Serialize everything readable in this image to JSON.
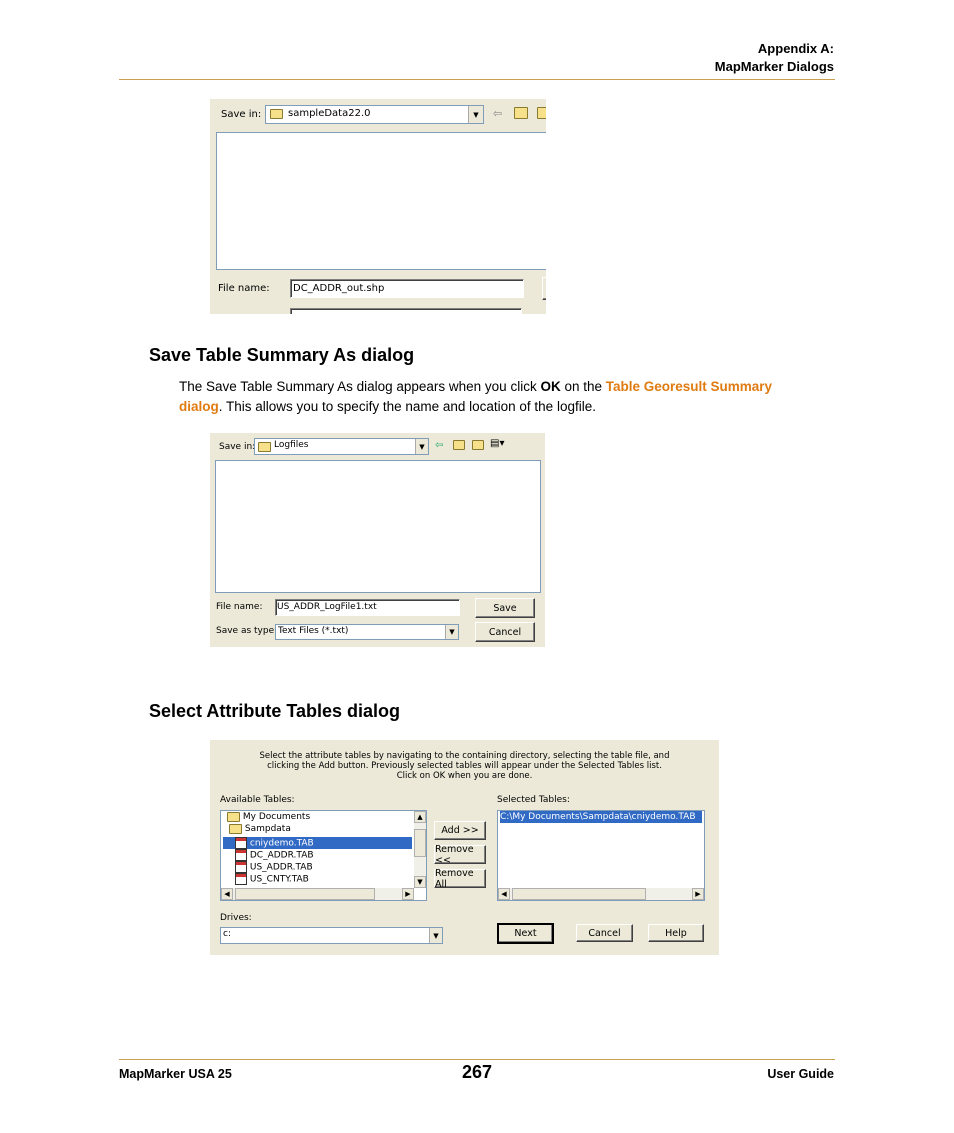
{
  "header": {
    "line1": "Appendix A:",
    "line2": "MapMarker Dialogs"
  },
  "dialog1": {
    "save_in_label": "Save in:",
    "save_in_value": "sampleData22.0",
    "file_name_label": "File name:",
    "file_name_value": "DC_ADDR_out.shp"
  },
  "section1": {
    "heading": "Save Table Summary As dialog",
    "para_a": "The Save Table Summary As dialog appears when you click ",
    "para_ok": "OK",
    "para_b": " on the ",
    "para_link1": "Table Georesult Summary",
    "para_link2": "dialog",
    "para_c": ". This allows you to specify the name and location of the logfile."
  },
  "dialog2": {
    "save_in_label": "Save in:",
    "save_in_value": "Logfiles",
    "file_name_label": "File name:",
    "file_name_value": "US_ADDR_LogFile1.txt",
    "save_as_label": "Save as type:",
    "save_as_value": "Text Files (*.txt)",
    "save_button": "Save",
    "cancel_button": "Cancel"
  },
  "section2": {
    "heading": "Select Attribute Tables dialog"
  },
  "dialog3": {
    "instructions": [
      "Select the attribute tables by navigating to the containing directory, selecting the table file, and",
      "clicking  the Add button.  Previously selected tables will appear under the Selected Tables list.",
      "Click on OK when you are done."
    ],
    "available_label": "Available Tables:",
    "selected_label": "Selected Tables:",
    "available_items": [
      "My Documents",
      "Sampdata",
      "cniydemo.TAB",
      "DC_ADDR.TAB",
      "US_ADDR.TAB",
      "US_CNTY.TAB"
    ],
    "selected_items": [
      "C:\\My Documents\\Sampdata\\cniydemo.TAB"
    ],
    "add_button": "Add >>",
    "remove_button": "Remove <<",
    "remove_all_button": "Remove All",
    "drives_label": "Drives:",
    "drives_value": "c:",
    "next_button": "Next",
    "cancel_button": "Cancel",
    "help_button": "Help"
  },
  "footer": {
    "left": "MapMarker USA 25",
    "page": "267",
    "right": "User Guide"
  }
}
